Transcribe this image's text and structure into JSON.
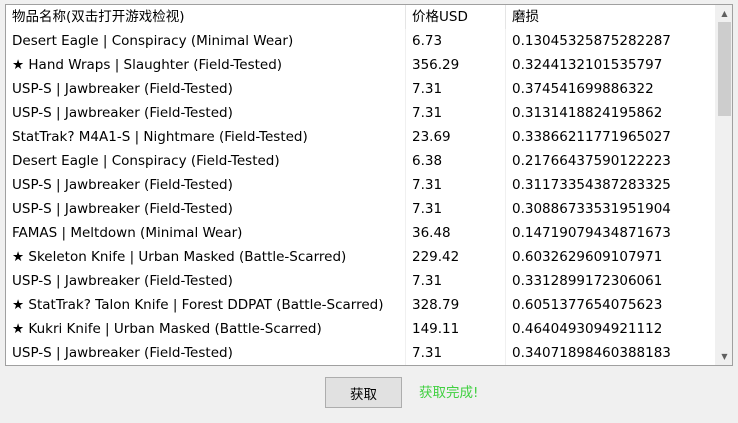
{
  "table": {
    "columns": [
      "物品名称(双击打开游戏检视)",
      "价格USD",
      "磨损"
    ],
    "rows": [
      [
        "Desert Eagle | Conspiracy (Minimal Wear)",
        "6.73",
        "0.13045325875282287"
      ],
      [
        "★ Hand Wraps | Slaughter (Field-Tested)",
        "356.29",
        "0.3244132101535797"
      ],
      [
        "USP-S | Jawbreaker (Field-Tested)",
        "7.31",
        "0.374541699886322"
      ],
      [
        "USP-S | Jawbreaker (Field-Tested)",
        "7.31",
        "0.3131418824195862"
      ],
      [
        "StatTrak? M4A1-S | Nightmare (Field-Tested)",
        "23.69",
        "0.33866211771965027"
      ],
      [
        "Desert Eagle | Conspiracy (Field-Tested)",
        "6.38",
        "0.21766437590122223"
      ],
      [
        "USP-S | Jawbreaker (Field-Tested)",
        "7.31",
        "0.31173354387283325"
      ],
      [
        "USP-S | Jawbreaker (Field-Tested)",
        "7.31",
        "0.30886733531951904"
      ],
      [
        "FAMAS | Meltdown (Minimal Wear)",
        "36.48",
        "0.14719079434871673"
      ],
      [
        "★ Skeleton Knife | Urban Masked (Battle-Scarred)",
        "229.42",
        "0.6032629609107971"
      ],
      [
        "USP-S | Jawbreaker (Field-Tested)",
        "7.31",
        "0.3312899172306061"
      ],
      [
        "★ StatTrak? Talon Knife | Forest DDPAT (Battle-Scarred)",
        "328.79",
        "0.6051377654075623"
      ],
      [
        "★ Kukri Knife | Urban Masked (Battle-Scarred)",
        "149.11",
        "0.4640493094921112"
      ],
      [
        "USP-S | Jawbreaker (Field-Tested)",
        "7.31",
        "0.34071898460388183"
      ]
    ]
  },
  "scrollbar": {
    "up_icon": "▲",
    "down_icon": "▼"
  },
  "actions": {
    "fetch_label": "获取"
  },
  "status": {
    "text": "获取完成!",
    "color": "#40d040"
  }
}
